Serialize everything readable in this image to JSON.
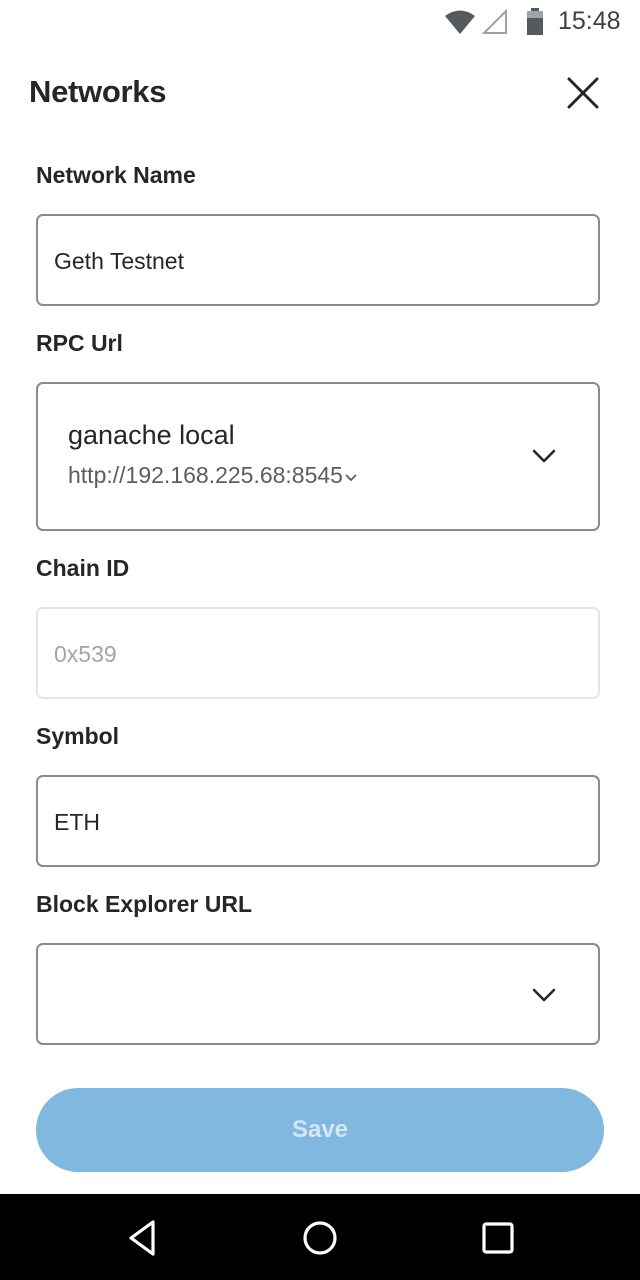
{
  "status_bar": {
    "time": "15:48",
    "icons": [
      "wifi-icon",
      "signal-icon",
      "battery-icon"
    ]
  },
  "header": {
    "title": "Networks",
    "close_icon": "close-icon"
  },
  "form": {
    "network_name": {
      "label": "Network Name",
      "value": "Geth Testnet"
    },
    "rpc_url": {
      "label": "RPC Url",
      "name": "ganache local",
      "url": "http://192.168.225.68:8545"
    },
    "chain_id": {
      "label": "Chain ID",
      "placeholder": "0x539"
    },
    "symbol": {
      "label": "Symbol",
      "value": "ETH"
    },
    "block_explorer": {
      "label": "Block Explorer URL",
      "value": ""
    }
  },
  "save_button": {
    "label": "Save",
    "color": "#80b8e0"
  },
  "nav_bar": {
    "icons": [
      "back-icon",
      "home-icon",
      "recents-icon"
    ]
  }
}
